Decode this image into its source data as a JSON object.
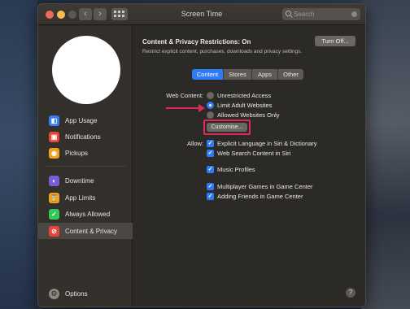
{
  "window": {
    "title": "Screen Time"
  },
  "toolbar": {
    "back_glyph": "‹",
    "forward_glyph": "›",
    "search_placeholder": "Search"
  },
  "sidebar": {
    "items": [
      {
        "label": "App Usage",
        "icon": "app-usage-icon",
        "color": "#3b7df0",
        "glyph": "◧"
      },
      {
        "label": "Notifications",
        "icon": "notifications-icon",
        "color": "#e8453c",
        "glyph": "▣"
      },
      {
        "label": "Pickups",
        "icon": "pickups-icon",
        "color": "#f0a21f",
        "glyph": "◉"
      },
      {
        "label": "Downtime",
        "icon": "downtime-icon",
        "color": "#7b5cd6",
        "glyph": "◐"
      },
      {
        "label": "App Limits",
        "icon": "app-limits-icon",
        "color": "#f0a21f",
        "glyph": "⌛"
      },
      {
        "label": "Always Allowed",
        "icon": "always-allowed-icon",
        "color": "#34c759",
        "glyph": "✓"
      },
      {
        "label": "Content & Privacy",
        "icon": "content-privacy-icon",
        "color": "#e8453c",
        "glyph": "⊘",
        "selected": true
      }
    ],
    "options_label": "Options"
  },
  "header": {
    "title": "Content & Privacy Restrictions: On",
    "description": "Restrict explicit content, purchases, downloads and privacy settings.",
    "turn_off_label": "Turn Off..."
  },
  "tabs": [
    {
      "label": "Content",
      "active": true
    },
    {
      "label": "Stores",
      "active": false
    },
    {
      "label": "Apps",
      "active": false
    },
    {
      "label": "Other",
      "active": false
    }
  ],
  "web_content": {
    "label": "Web Content:",
    "options": [
      {
        "label": "Unrestricted Access",
        "selected": false
      },
      {
        "label": "Limit Adult Websites",
        "selected": true
      },
      {
        "label": "Allowed Websites Only",
        "selected": false
      }
    ],
    "customise_label": "Customise..."
  },
  "allow": {
    "label": "Allow:",
    "items": [
      {
        "label": "Explicit Language in Siri & Dictionary",
        "checked": true
      },
      {
        "label": "Web Search Content in Siri",
        "checked": true
      },
      {
        "label": "Music Profiles",
        "checked": true
      },
      {
        "label": "Multiplayer Games in Game Center",
        "checked": true
      },
      {
        "label": "Adding Friends in Game Center",
        "checked": true
      }
    ]
  },
  "help_label": "?",
  "colors": {
    "accent": "#2f7bf6",
    "highlight": "#e02a55"
  }
}
